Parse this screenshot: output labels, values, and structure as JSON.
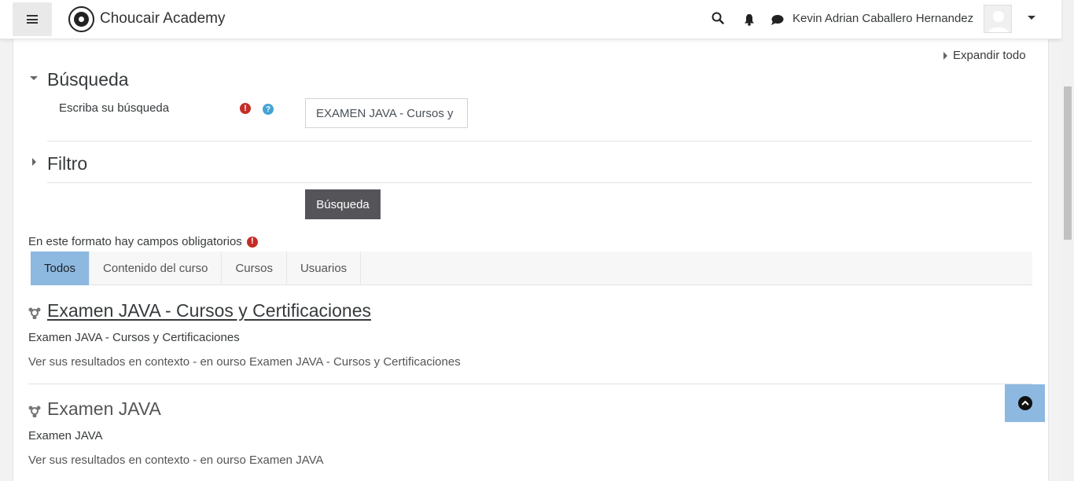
{
  "navbar": {
    "brand": "Choucair Academy",
    "user_name": "Kevin Adrian Caballero Hernandez",
    "icons": [
      "menu-icon",
      "search-icon",
      "bell-icon",
      "chat-icon",
      "chevron-down-icon"
    ]
  },
  "form": {
    "expand_all": "Expandir todo",
    "search_section": "Búsqueda",
    "field_label": "Escriba su búsqueda",
    "search_value": "EXAMEN JAVA - Cursos y Certificaciones",
    "filter_section": "Filtro",
    "submit_label": "Búsqueda",
    "required_note": "En este formato hay campos obligatorios"
  },
  "tabs": [
    {
      "label": "Todos",
      "active": true
    },
    {
      "label": "Contenido del curso",
      "active": false
    },
    {
      "label": "Cursos",
      "active": false
    },
    {
      "label": "Usuarios",
      "active": false
    }
  ],
  "results": [
    {
      "title": "Examen JAVA - Cursos y Certificaciones",
      "description": "Examen JAVA - Cursos y Certificaciones",
      "context": "Ver sus resultados en contexto - en ourso Examen JAVA - Cursos y Certificaciones"
    },
    {
      "title": "Examen JAVA",
      "description": "Examen JAVA",
      "context": "Ver sus resultados en contexto - en ourso Examen JAVA"
    }
  ],
  "colors": {
    "accent": "#8db8e0",
    "button": "#555459",
    "required": "#c42e27",
    "help": "#45a3d5"
  }
}
